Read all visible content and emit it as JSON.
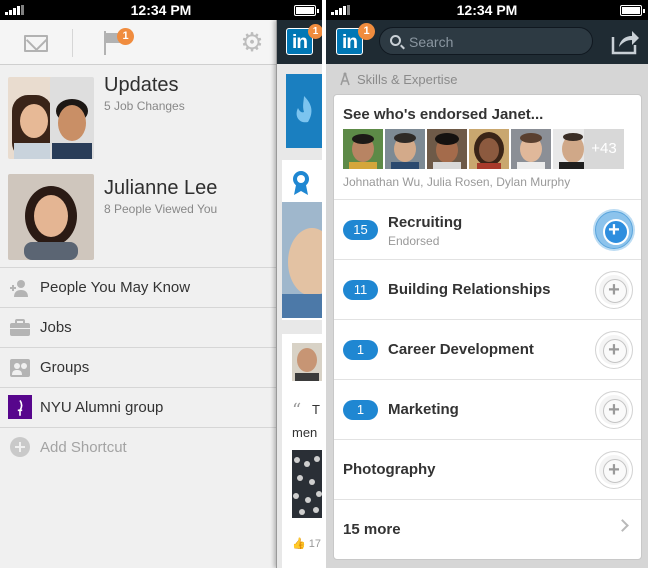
{
  "status_bar": {
    "time": "12:34 PM"
  },
  "left_screen": {
    "top_bar": {
      "notification_count": "1"
    },
    "updates": {
      "title": "Updates",
      "subtitle": "5 Job Changes"
    },
    "profile": {
      "name": "Julianne Lee",
      "subtitle": "8 People Viewed You"
    },
    "menu_items": [
      {
        "label": "People You May Know",
        "icon": "people-icon"
      },
      {
        "label": "Jobs",
        "icon": "briefcase-icon"
      },
      {
        "label": "Groups",
        "icon": "groups-icon"
      },
      {
        "label": "NYU Alumni group",
        "icon": "nyu-logo"
      },
      {
        "label": "Add Shortcut",
        "icon": "add-icon"
      }
    ],
    "peek_badge": "1"
  },
  "right_screen": {
    "top_bar": {
      "badge": "1",
      "search_placeholder": "Search"
    },
    "section_title": "Skills & Expertise",
    "endorsements": {
      "title": "See who's endorsed Janet...",
      "more_count": "+43",
      "names": "Johnathan Wu, Julia Rosen, Dylan Murphy"
    },
    "skills": [
      {
        "count": "15",
        "name": "Recruiting",
        "sub": "Endorsed",
        "endorsed": true
      },
      {
        "count": "11",
        "name": "Building Relationships",
        "sub": "",
        "endorsed": false
      },
      {
        "count": "1",
        "name": "Career Development",
        "sub": "",
        "endorsed": false
      },
      {
        "count": "1",
        "name": "Marketing",
        "sub": "",
        "endorsed": false
      },
      {
        "count": "",
        "name": "Photography",
        "sub": "",
        "endorsed": false
      }
    ],
    "more_label": "15 more"
  },
  "colors": {
    "linkedin_blue": "#0077b5",
    "badge_orange": "#f08c3e",
    "pill_blue": "#1f87d2",
    "nav_dark": "#1f2b33"
  }
}
